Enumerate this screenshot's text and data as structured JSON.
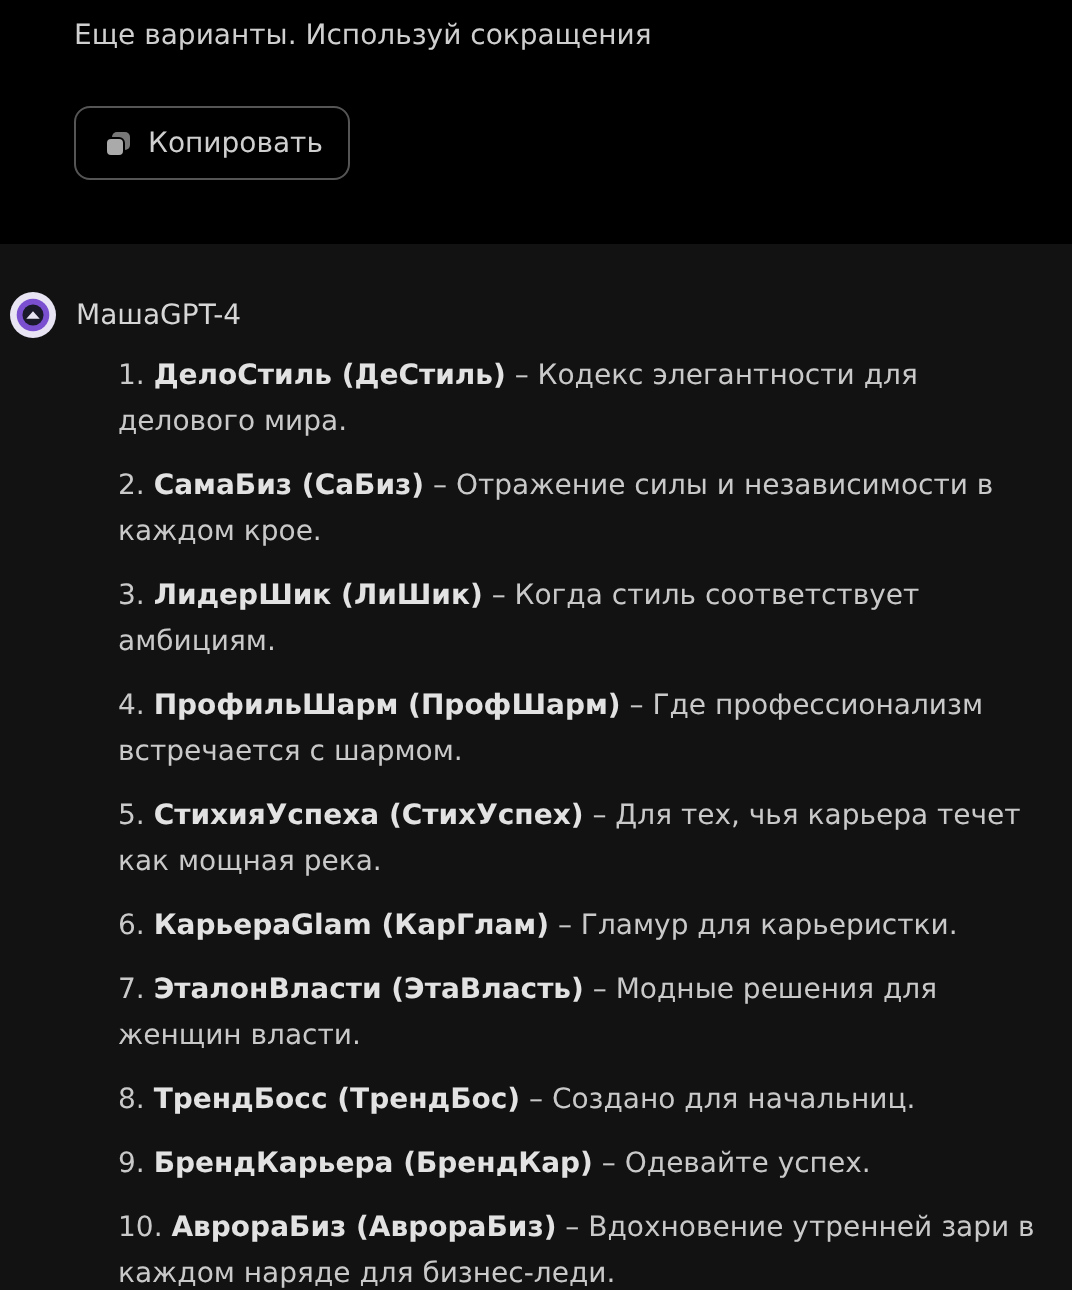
{
  "user_message": {
    "text": "Еще варианты. Используй сокращения",
    "copy_button": "Копировать"
  },
  "reply": {
    "author": "МашаGPT-4",
    "items": [
      "1. **ДелоСтиль (ДеСтиль)** – Кодекс элегантности для делового мира.",
      "2. **СамаБиз (СаБиз)** – Отражение силы и независимости в каждом крое.",
      "3. **ЛидерШик (ЛиШик)** – Когда стиль соответствует амбициям.",
      "4. **ПрофильШарм (ПрофШарм)** – Где профессионализм встречается с шармом.",
      "5. **СтихияУспеха (СтихУспех)** – Для тех, чья карьера течет как мощная река.",
      "6. **КарьераGlam (КарГлам)** – Гламур для карьеристки.",
      "7. **ЭталонВласти (ЭтаВласть)** – Модные решения для женщин власти.",
      "8. **ТрендБосс (ТрендБос)** – Создано для начальниц.",
      "9. **БрендКарьера (БрендКар)** – Одевайте успех.",
      "10. **АврораБиз (АврораБиз)** – Вдохновение утренней зари в каждом наряде для бизнес-леди."
    ]
  }
}
